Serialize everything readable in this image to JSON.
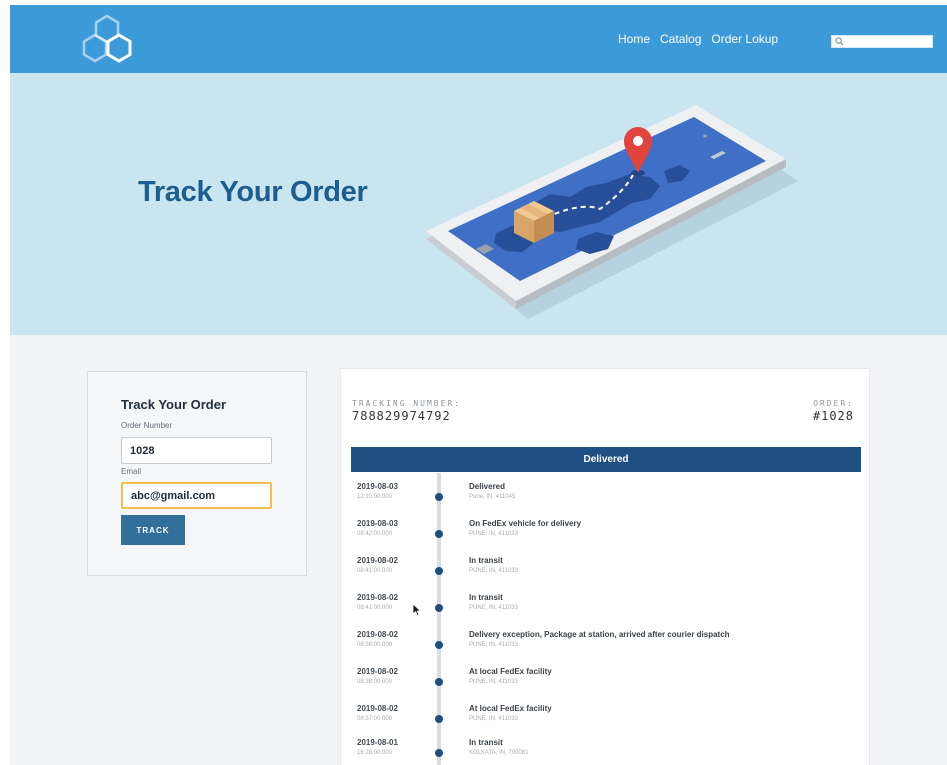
{
  "nav": {
    "links": [
      "Home",
      "Catalog",
      "Order Lokup"
    ],
    "search_placeholder": ""
  },
  "hero": {
    "title": "Track Your Order"
  },
  "form": {
    "title": "Track Your Order",
    "order_label": "Order Number",
    "order_value": "1028",
    "email_label": "Email",
    "email_value": "abc@gmail.com",
    "button_label": "TRACK"
  },
  "tracking": {
    "tracking_label": "TRACKING NUMBER:",
    "tracking_number": "788829974792",
    "order_label": "ORDER:",
    "order_number": "#1028",
    "status": "Delivered",
    "events": [
      {
        "date": "2019-08-03",
        "time": "12:10:00.000",
        "desc": "Delivered",
        "loc": "Pune, IN, 411045"
      },
      {
        "date": "2019-08-03",
        "time": "08:42:00.000",
        "desc": "On FedEx vehicle for delivery",
        "loc": "PUNE, IN, 411033"
      },
      {
        "date": "2019-08-02",
        "time": "08:41:00.000",
        "desc": "In transit",
        "loc": "PUNE, IN, 411033"
      },
      {
        "date": "2019-08-02",
        "time": "08:41:00.000",
        "desc": "In transit",
        "loc": "PUNE, IN, 411033"
      },
      {
        "date": "2019-08-02",
        "time": "08:38:00.000",
        "desc": "Delivery exception, Package at station, arrived after courier dispatch",
        "loc": "PUNE, IN, 411033"
      },
      {
        "date": "2019-08-02",
        "time": "08:38:00.000",
        "desc": "At local FedEx facility",
        "loc": "PUNE, IN, 411033"
      },
      {
        "date": "2019-08-02",
        "time": "08:37:00.000",
        "desc": "At local FedEx facility",
        "loc": "PUNE, IN, 411033"
      },
      {
        "date": "2019-08-01",
        "time": "16:28:00.000",
        "desc": "In transit",
        "loc": "KOLKATA, IN, 700081"
      }
    ]
  },
  "colors": {
    "header": "#3d9ad8",
    "hero_bg": "#c9e5ef",
    "title": "#1d5d8f",
    "status_bar": "#1f4f83",
    "button": "#326f9a",
    "focus_border": "#f0c04c"
  }
}
